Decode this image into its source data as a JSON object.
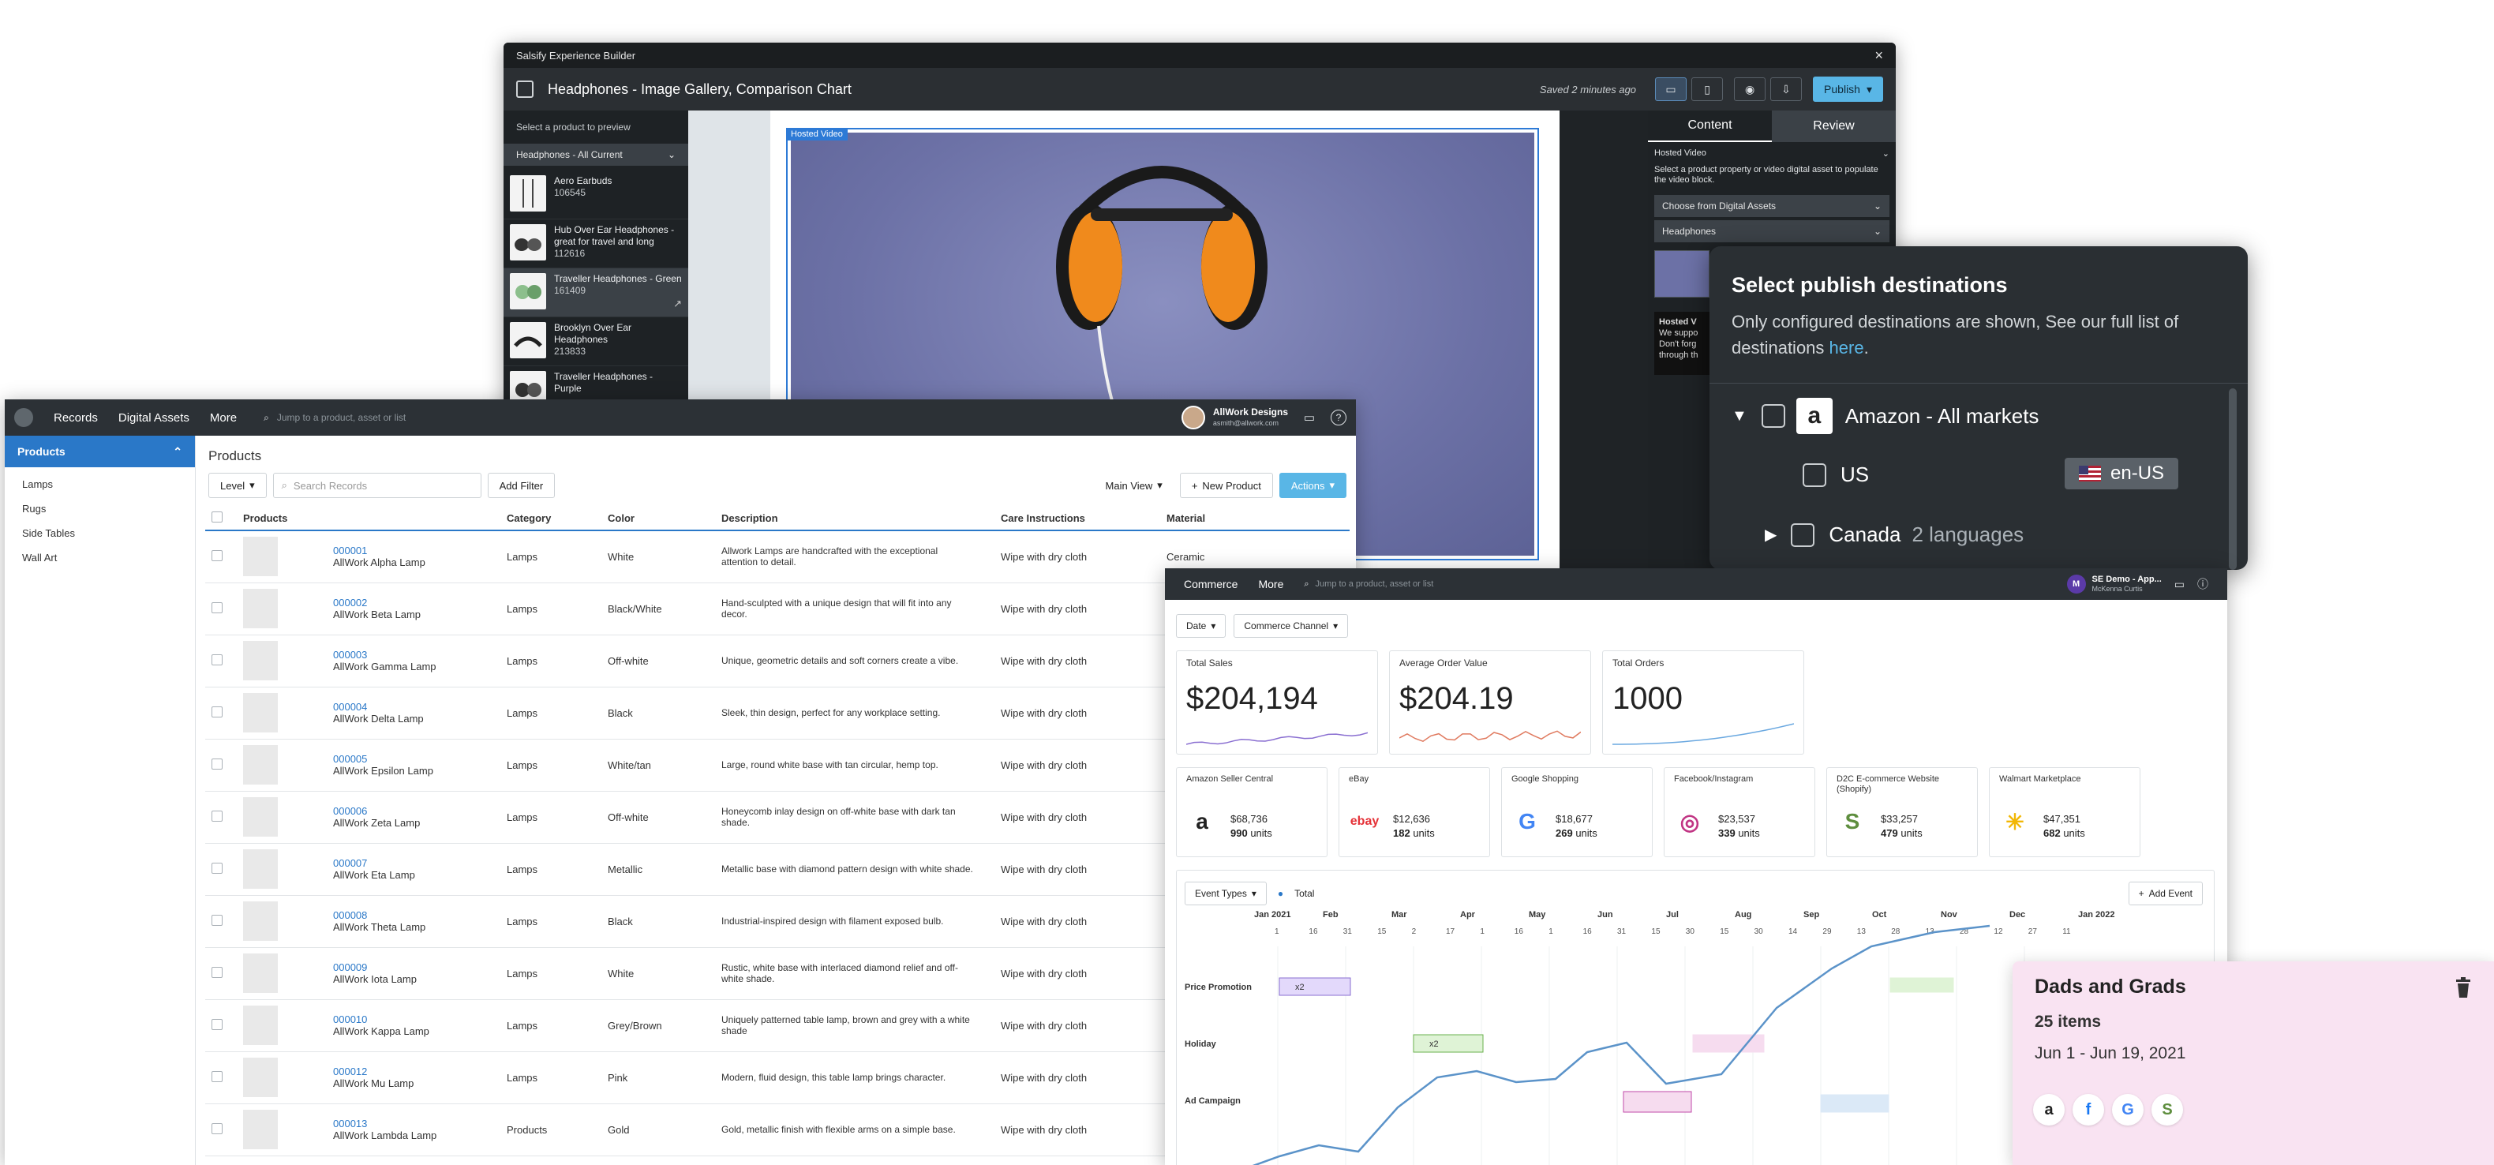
{
  "builder": {
    "window_title": "Salsify Experience Builder",
    "close_glyph": "×",
    "doc_title": "Headphones - Image Gallery, Comparison Chart",
    "saved_text": "Saved 2 minutes ago",
    "publish_label": "Publish",
    "left_hint": "Select a product to preview",
    "product_filter": "Headphones - All Current",
    "products": [
      {
        "name": "Aero Earbuds",
        "id": "106545"
      },
      {
        "name": "Hub Over Ear Headphones - great for travel and long",
        "id": "112616"
      },
      {
        "name": "Traveller Headphones - Green",
        "id": "161409"
      },
      {
        "name": "Brooklyn Over Ear Headphones",
        "id": "213833"
      },
      {
        "name": "Traveller Headphones - Purple",
        "id": ""
      }
    ],
    "video_tag": "Hosted Video",
    "tabs": {
      "content": "Content",
      "review": "Review"
    },
    "panel_section": "Hosted Video",
    "panel_hint": "Select a product property or video digital asset to populate the video block.",
    "choose_label": "Choose from Digital Assets",
    "headphones_label": "Headphones",
    "preview_title": "Hosted V",
    "preview_line1": "We suppo",
    "preview_line2": "Don't forg",
    "preview_line3": "through th"
  },
  "publish_popup": {
    "title": "Select publish destinations",
    "subtitle": "Only configured destinations are shown, See our full list of destinations ",
    "link": "here",
    "link_tail": ".",
    "amazon": "Amazon - All markets",
    "us": "US",
    "locale": "en-US",
    "canada": "Canada",
    "canada_langs": "2 languages"
  },
  "pim": {
    "nav": {
      "records": "Records",
      "assets": "Digital Assets",
      "more": "More",
      "search_placeholder": "Jump to a product, asset or list"
    },
    "user": {
      "name": "AllWork Designs",
      "email": "asmith@allwork.com"
    },
    "sidebar": {
      "header": "Products",
      "items": [
        "Lamps",
        "Rugs",
        "Side Tables",
        "Wall Art"
      ]
    },
    "page_title": "Products",
    "filters": {
      "level": "Level",
      "search_placeholder": "Search Records",
      "add_filter": "Add Filter",
      "view": "Main View",
      "new_product": "New Product",
      "actions": "Actions"
    },
    "columns": [
      "Products",
      "Category",
      "Color",
      "Description",
      "Care Instructions",
      "Material"
    ],
    "rows": [
      {
        "id": "000001",
        "name": "AllWork Alpha Lamp",
        "category": "Lamps",
        "color": "White",
        "desc": "Allwork Lamps are handcrafted with the exceptional attention to detail.",
        "care": "Wipe with dry cloth",
        "material": "Ceramic"
      },
      {
        "id": "000002",
        "name": "AllWork Beta Lamp",
        "category": "Lamps",
        "color": "Black/White",
        "desc": "Hand-sculpted with a unique design that will fit into any decor.",
        "care": "Wipe with dry cloth",
        "material": ""
      },
      {
        "id": "000003",
        "name": "AllWork Gamma Lamp",
        "category": "Lamps",
        "color": "Off-white",
        "desc": "Unique, geometric details and soft corners create a vibe.",
        "care": "Wipe with dry cloth",
        "material": ""
      },
      {
        "id": "000004",
        "name": "AllWork Delta Lamp",
        "category": "Lamps",
        "color": "Black",
        "desc": "Sleek, thin design, perfect for any workplace setting.",
        "care": "Wipe with dry cloth",
        "material": ""
      },
      {
        "id": "000005",
        "name": "AllWork Epsilon Lamp",
        "category": "Lamps",
        "color": "White/tan",
        "desc": "Large, round white base with tan circular, hemp top.",
        "care": "Wipe with dry cloth",
        "material": ""
      },
      {
        "id": "000006",
        "name": "AllWork Zeta Lamp",
        "category": "Lamps",
        "color": "Off-white",
        "desc": "Honeycomb inlay design on off-white base with dark tan shade.",
        "care": "Wipe with dry cloth",
        "material": ""
      },
      {
        "id": "000007",
        "name": "AllWork Eta Lamp",
        "category": "Lamps",
        "color": "Metallic",
        "desc": "Metallic base with diamond pattern design with white shade.",
        "care": "Wipe with dry cloth",
        "material": ""
      },
      {
        "id": "000008",
        "name": "AllWork Theta Lamp",
        "category": "Lamps",
        "color": "Black",
        "desc": "Industrial-inspired design with filament exposed bulb.",
        "care": "Wipe with dry cloth",
        "material": ""
      },
      {
        "id": "000009",
        "name": "AllWork Iota Lamp",
        "category": "Lamps",
        "color": "White",
        "desc": "Rustic, white base with interlaced diamond relief and off-white shade.",
        "care": "Wipe with dry cloth",
        "material": ""
      },
      {
        "id": "000010",
        "name": "AllWork Kappa Lamp",
        "category": "Lamps",
        "color": "Grey/Brown",
        "desc": "Uniquely patterned table lamp, brown and grey with a white shade",
        "care": "Wipe with dry cloth",
        "material": ""
      },
      {
        "id": "000012",
        "name": "AllWork Mu Lamp",
        "category": "Lamps",
        "color": "Pink",
        "desc": "Modern, fluid design, this table lamp brings character.",
        "care": "Wipe with dry cloth",
        "material": ""
      },
      {
        "id": "000013",
        "name": "AllWork Lambda Lamp",
        "category": "Products",
        "color": "Gold",
        "desc": "Gold, metallic finish with flexible arms on a simple base.",
        "care": "Wipe with dry cloth",
        "material": ""
      }
    ]
  },
  "commerce": {
    "nav": {
      "commerce": "Commerce",
      "more": "More",
      "search_placeholder": "Jump to a product, asset or list"
    },
    "user": {
      "initial": "M",
      "name": "SE Demo - App...",
      "email": "McKenna Curtis"
    },
    "filters": {
      "date": "Date",
      "channel": "Commerce Channel"
    },
    "kpis": [
      {
        "label": "Total Sales",
        "value": "$204,194",
        "color": "#8a6fd1"
      },
      {
        "label": "Average Order Value",
        "value": "$204.19",
        "color": "#e07a5f"
      },
      {
        "label": "Total Orders",
        "value": "1000",
        "color": "#6aa8e0"
      }
    ],
    "channels": [
      {
        "label": "Amazon Seller Central",
        "value": "$68,736",
        "units": "990",
        "logo": "a",
        "logo_color": "#222"
      },
      {
        "label": "eBay",
        "value": "$12,636",
        "units": "182",
        "logo": "ebay",
        "logo_color": "#e53238"
      },
      {
        "label": "Google Shopping",
        "value": "$18,677",
        "units": "269",
        "logo": "G",
        "logo_color": "#4285f4"
      },
      {
        "label": "Facebook/Instagram",
        "value": "$23,537",
        "units": "339",
        "logo": "◎",
        "logo_color": "#c13584"
      },
      {
        "label": "D2C E-commerce Website (Shopify)",
        "value": "$33,257",
        "units": "479",
        "logo": "S",
        "logo_color": "#5e8e3e"
      },
      {
        "label": "Walmart Marketplace",
        "value": "$47,351",
        "units": "682",
        "logo": "✳",
        "logo_color": "#f2b705"
      }
    ],
    "units_label": "units",
    "timeline": {
      "event_types": "Event Types",
      "legend": "Total",
      "add_event": "Add Event",
      "months": [
        "Jan 2021",
        "Feb",
        "Mar",
        "Apr",
        "May",
        "Jun",
        "Jul",
        "Aug",
        "Sep",
        "Oct",
        "Nov",
        "Dec",
        "Jan 2022"
      ],
      "days": [
        "1",
        "16",
        "31",
        "15",
        "2",
        "17",
        "1",
        "16",
        "1",
        "16",
        "31",
        "15",
        "30",
        "15",
        "30",
        "14",
        "29",
        "13",
        "28",
        "13",
        "28",
        "12",
        "27",
        "11"
      ],
      "rows": [
        "Price Promotion",
        "Holiday",
        "Ad Campaign"
      ],
      "badge1": "x2",
      "badge2": "x2"
    }
  },
  "campaign_card": {
    "title": "Dads and Grads",
    "items": "25 items",
    "dates": "Jun 1 - Jun 19, 2021",
    "logos": [
      {
        "glyph": "a",
        "color": "#222"
      },
      {
        "glyph": "f",
        "color": "#1877f2"
      },
      {
        "glyph": "G",
        "color": "#4285f4"
      },
      {
        "glyph": "S",
        "color": "#5e8e3e"
      }
    ]
  }
}
